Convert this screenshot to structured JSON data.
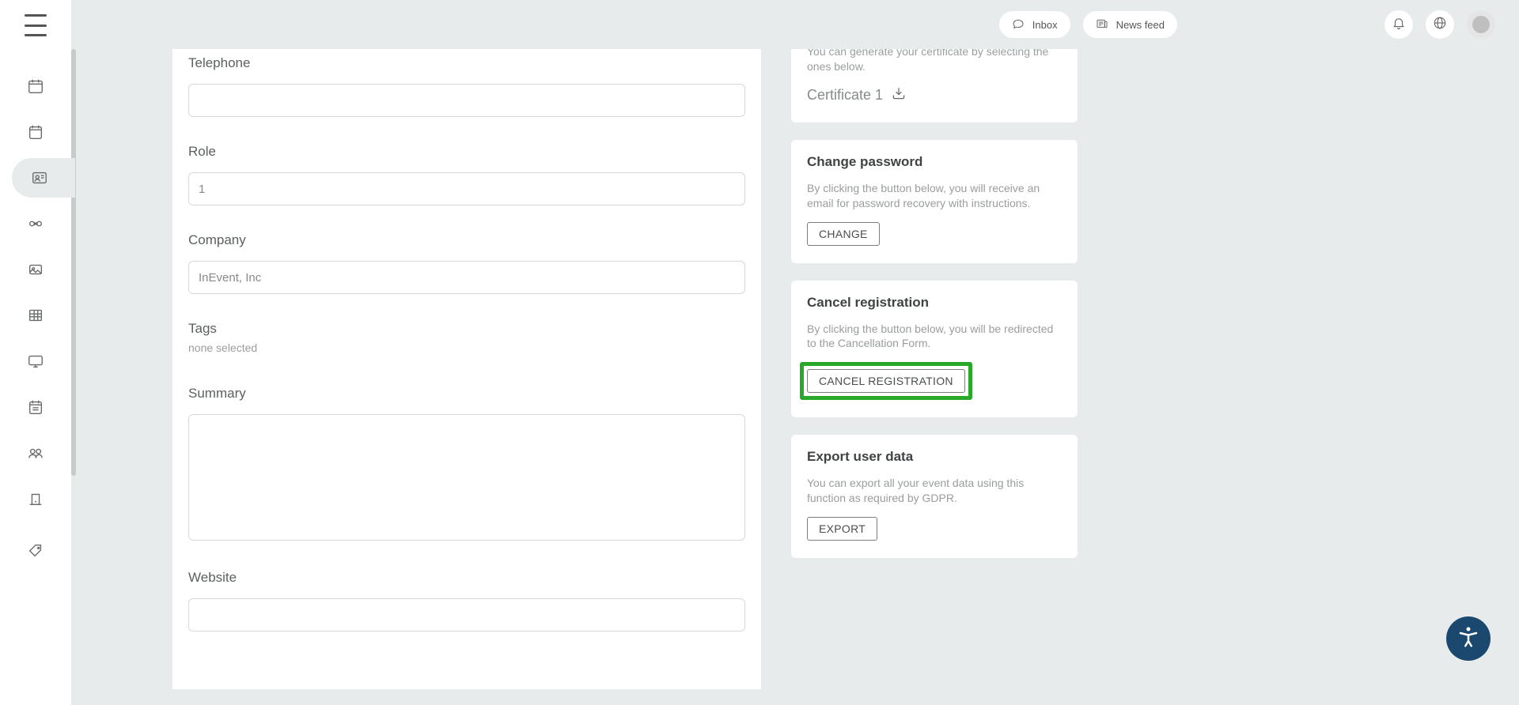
{
  "topbar": {
    "inbox_label": "Inbox",
    "newsfeed_label": "News feed"
  },
  "form": {
    "telephone_label": "Telephone",
    "telephone_value": "",
    "role_label": "Role",
    "role_value": "1",
    "company_label": "Company",
    "company_value": "InEvent, Inc",
    "tags_label": "Tags",
    "tags_none": "none selected",
    "summary_label": "Summary",
    "summary_value": "",
    "website_label": "Website",
    "website_value": ""
  },
  "certificate": {
    "hint_partial": "You can generate your certificate by selecting the ones below.",
    "item1": "Certificate 1"
  },
  "change_password": {
    "title": "Change password",
    "desc": "By clicking the button below, you will receive an email for password recovery with instructions.",
    "button": "CHANGE"
  },
  "cancel_registration": {
    "title": "Cancel registration",
    "desc": "By clicking the button below, you will be redirected to the Cancellation Form.",
    "button": "CANCEL REGISTRATION"
  },
  "export_data": {
    "title": "Export user data",
    "desc": "You can export all your event data using this function as required by GDPR.",
    "button": "EXPORT"
  },
  "colors": {
    "highlight": "#2aa82a",
    "fab": "#1b486e"
  }
}
